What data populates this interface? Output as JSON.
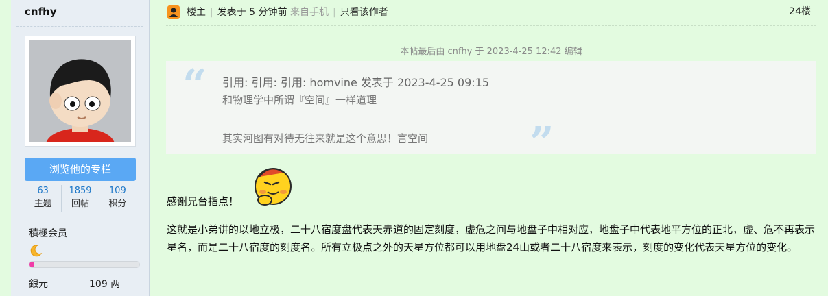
{
  "sidebar": {
    "username": "cnfhy",
    "follow_label": "浏览他的专栏",
    "stats": [
      {
        "num": "63",
        "label": "主题"
      },
      {
        "num": "1859",
        "label": "回帖"
      },
      {
        "num": "109",
        "label": "积分"
      }
    ],
    "rank": "積極会员",
    "level_progress": 0.04,
    "silver_label": "銀元",
    "silver_value": "109 两"
  },
  "post_header": {
    "op_label": "楼主",
    "posted_label": "发表于 5 分钟前",
    "source": "来自手机",
    "author_only": "只看该作者",
    "floor": "24楼"
  },
  "edit_note": "本帖最后由 cnfhy 于 2023-4-25 12:42 编辑",
  "quote": {
    "head": "引用: 引用: 引用: homvine 发表于 2023-4-25 09:15",
    "line1": "和物理学中所谓『空间』一样道理",
    "line2": "其实河图有对待无往来就是这个意思！言空间"
  },
  "post": {
    "thanks": "感谢兄台指点！",
    "body": "这就是小弟讲的以地立极，二十八宿度盘代表天赤道的固定刻度，虚危之间与地盘子中相对应，地盘子中代表地平方位的正北，虚、危不再表示星名，而是二十八宿度的刻度名。所有立极点之外的天星方位都可以用地盘24山或者二十八宿度来表示，刻度的变化代表天星方位的变化。"
  },
  "colors": {
    "page_bg": "#e3fbe0",
    "sidebar_bg": "#e8eef4",
    "button_bg": "#5aa8f4",
    "stat_num": "#1f78c8",
    "progress_fill": "#f03ca8"
  }
}
